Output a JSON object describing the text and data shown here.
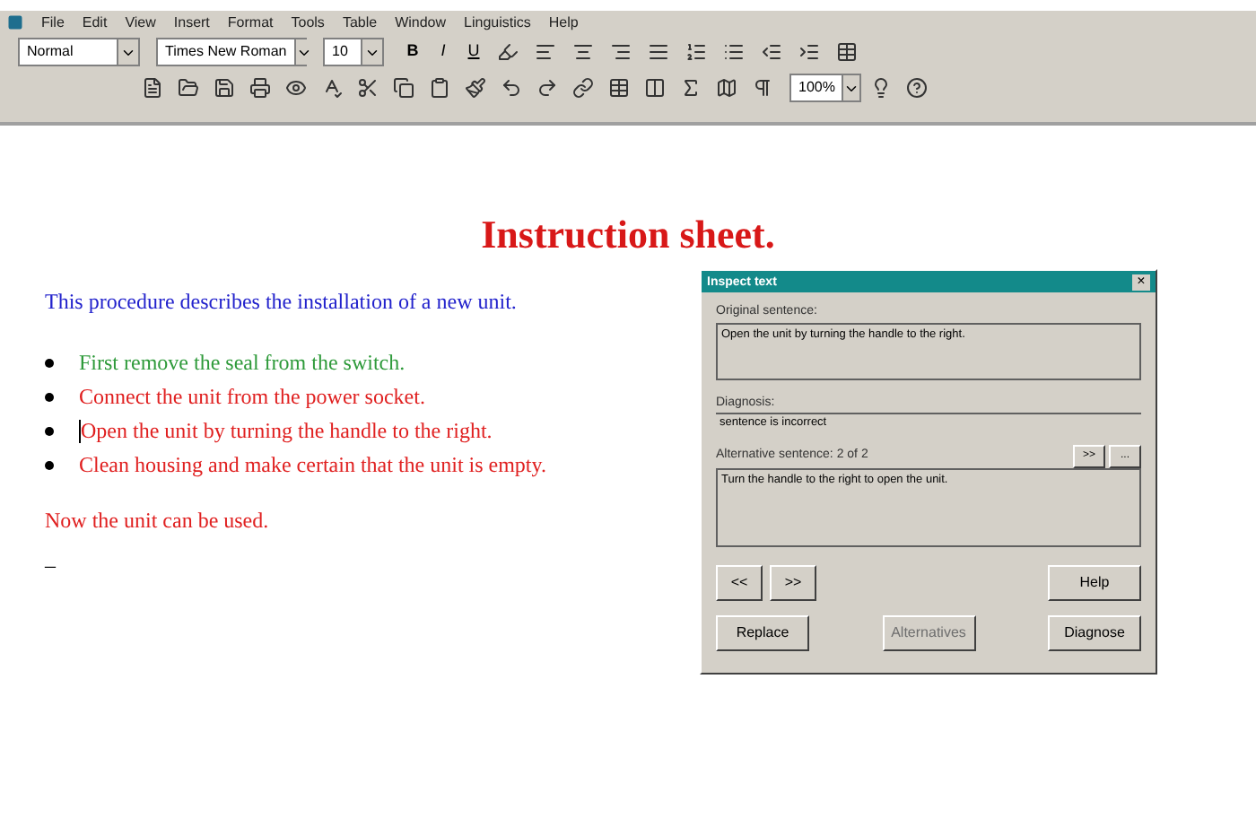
{
  "menu": [
    "File",
    "Edit",
    "View",
    "Insert",
    "Format",
    "Tools",
    "Table",
    "Window",
    "Linguistics",
    "Help"
  ],
  "format_bar": {
    "style": "Normal",
    "font": "Times New Roman",
    "size": "10",
    "bold": "B",
    "italic": "I",
    "underline": "U"
  },
  "standard_bar": {
    "zoom": "100%"
  },
  "document": {
    "title": "Instruction sheet.",
    "intro": "This procedure describes the installation of a new unit.",
    "bullets": [
      {
        "text": "First remove the seal from the switch.",
        "color": "#2e9a3a",
        "caret": false
      },
      {
        "text": "Connect the unit from the power socket.",
        "color": "#e02020",
        "caret": false
      },
      {
        "text": "Open the unit by turning the handle to the right.",
        "color": "#e02020",
        "caret": true
      },
      {
        "text": "Clean housing and make certain that the unit is empty.",
        "color": "#e02020",
        "caret": false
      }
    ],
    "closing": "Now the unit can be used.",
    "dash": "–"
  },
  "dialog": {
    "title": "Inspect text",
    "close": "×",
    "original_label": "Original sentence:",
    "original": "Open the unit by turning the handle to the right.",
    "diagnosis_label": "Diagnosis:",
    "diagnosis": "sentence is incorrect",
    "alternative_label": "Alternative sentence: 2 of 2",
    "alt_nav": [
      ">>",
      "..."
    ],
    "alternative": "Turn the handle to the right to open the unit.",
    "buttons": [
      {
        "label": "<<",
        "disabled": false
      },
      {
        "label": ">>",
        "disabled": false
      },
      {
        "label": "Help",
        "disabled": false
      },
      {
        "label": "Replace",
        "disabled": false
      },
      {
        "label": "Alternatives",
        "disabled": true
      },
      {
        "label": "Diagnose",
        "disabled": false
      }
    ]
  }
}
